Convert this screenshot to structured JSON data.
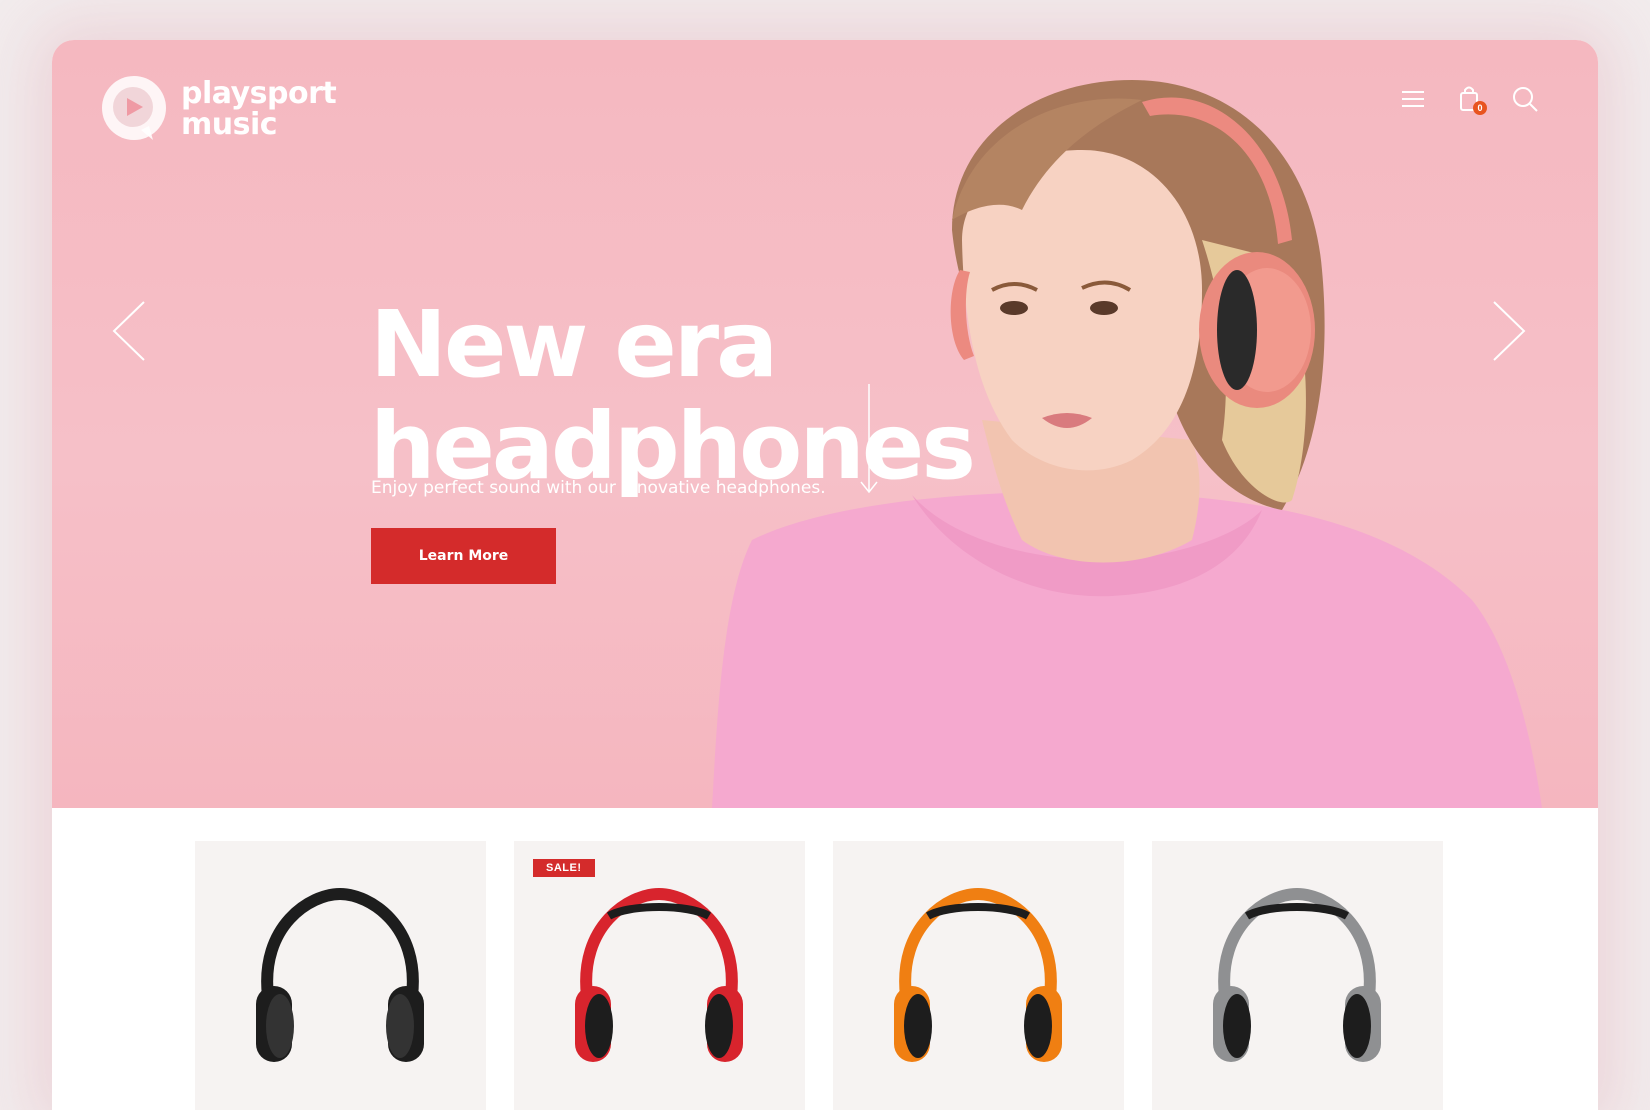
{
  "brand": {
    "line1": "playsport",
    "line2": "music"
  },
  "header": {
    "cart_count": "0",
    "icons": [
      "menu-icon",
      "cart-icon",
      "search-icon"
    ]
  },
  "hero": {
    "headline_line1": "New era",
    "headline_line2": "headphones",
    "subtitle": "Enjoy perfect sound with our innovative headphones.",
    "cta_label": "Learn More"
  },
  "products": [
    {
      "color_name": "black",
      "color": "#1d1d1d",
      "badge": ""
    },
    {
      "color_name": "red",
      "color": "#d8242d",
      "badge": "SALE!"
    },
    {
      "color_name": "orange",
      "color": "#f07f12",
      "badge": ""
    },
    {
      "color_name": "gray",
      "color": "#8f9092",
      "badge": ""
    }
  ],
  "colors": {
    "accent": "#d42b2b",
    "hero_bg": "#f5b8c0",
    "badge_orange": "#e8541f"
  }
}
